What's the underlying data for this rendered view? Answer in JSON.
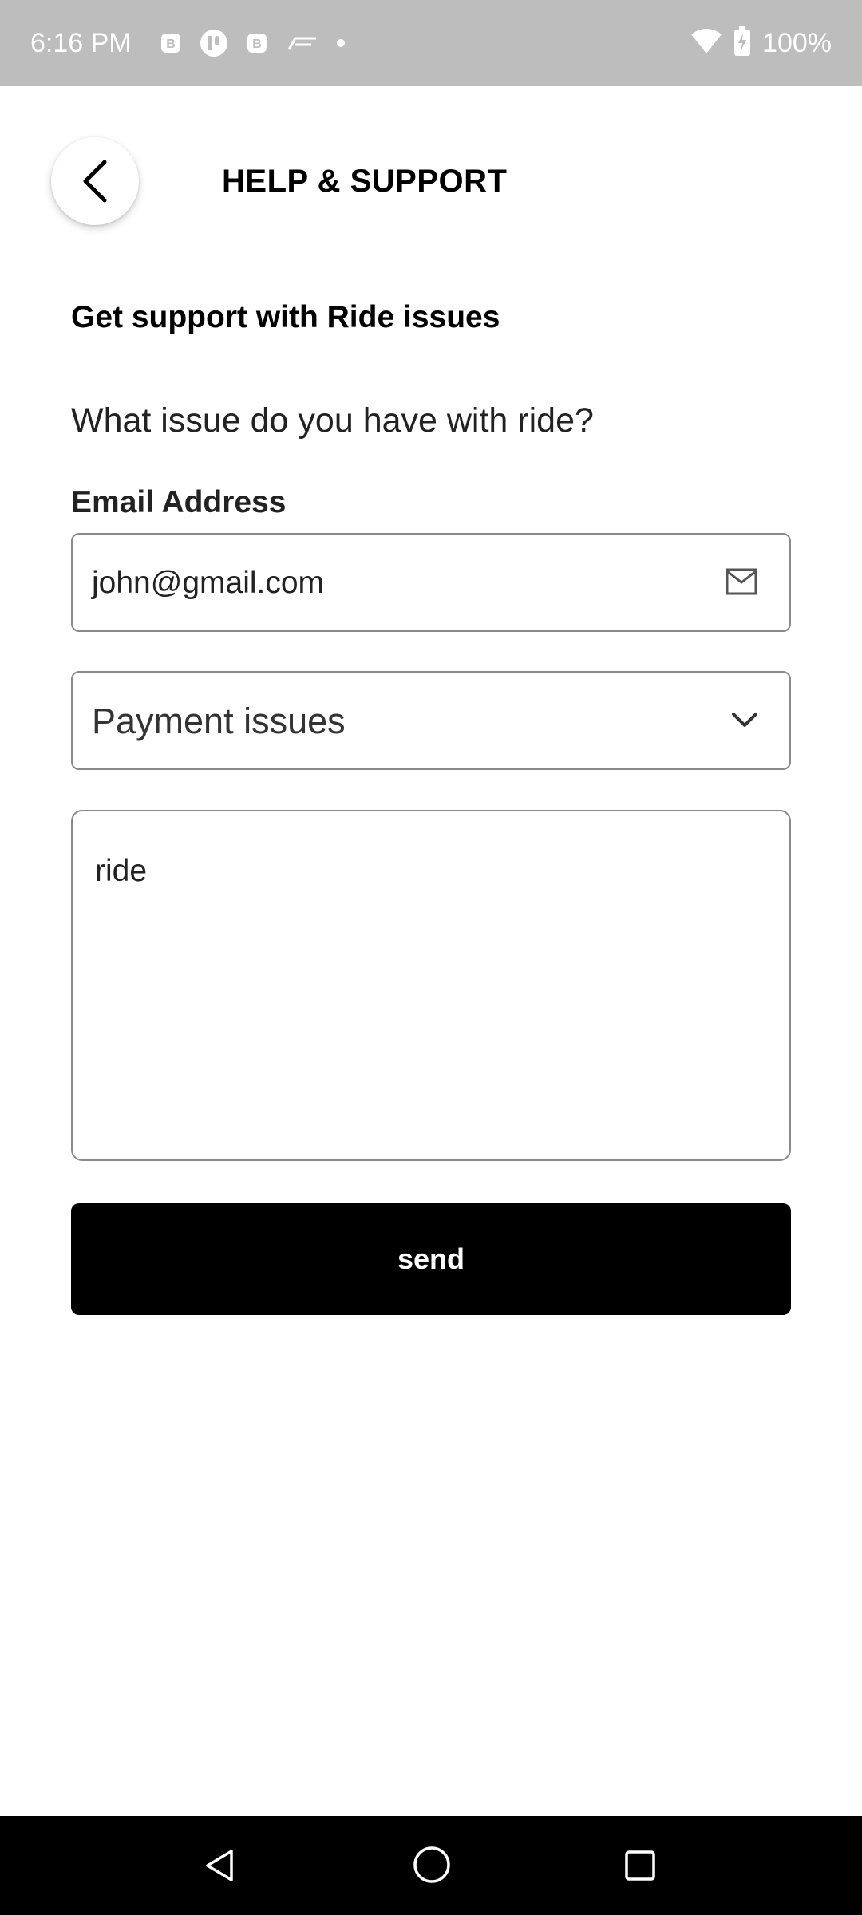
{
  "status_bar": {
    "time": "6:16 PM",
    "battery": "100%",
    "icons": [
      "b-app-icon",
      "sound-app-icon",
      "b-app-icon",
      "flag-app-icon",
      "dot-icon",
      "wifi-icon",
      "battery-charging-icon"
    ]
  },
  "header": {
    "title": "HELP & SUPPORT",
    "back_icon": "chevron-left-icon"
  },
  "form": {
    "heading": "Get support with Ride issues",
    "question": "What issue do you have with ride?",
    "email_label": "Email Address",
    "email_value": "john@gmail.com",
    "email_icon": "mail-icon",
    "issue_selected": "Payment issues",
    "issue_icon": "chevron-down-icon",
    "message_value": "ride",
    "send_label": "send"
  },
  "nav_bar": {
    "icons": [
      "nav-back-icon",
      "nav-home-icon",
      "nav-recents-icon"
    ]
  }
}
